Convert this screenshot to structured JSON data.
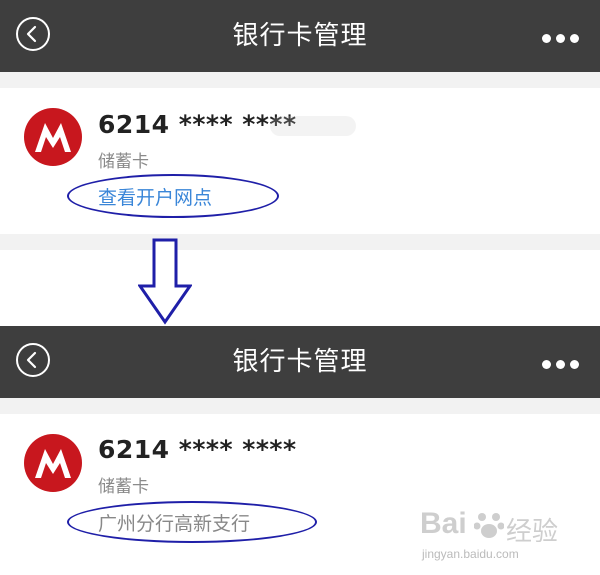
{
  "screens": [
    {
      "title": "银行卡管理",
      "card_number": "6214 **** ****",
      "card_type": "储蓄卡",
      "link_text": "查看开户网点"
    },
    {
      "title": "银行卡管理",
      "card_number": "6214 **** ****",
      "card_type": "储蓄卡",
      "link_text": "广州分行高新支行"
    }
  ],
  "watermark": {
    "brand": "Bai",
    "brand_cn": "经验",
    "url": "jingyan.baidu.com"
  },
  "colors": {
    "navbar": "#3e3e3e",
    "link": "#3a86d8",
    "branch": "#888888",
    "annotation": "#1f1fa8",
    "logo_red": "#c8171e"
  }
}
